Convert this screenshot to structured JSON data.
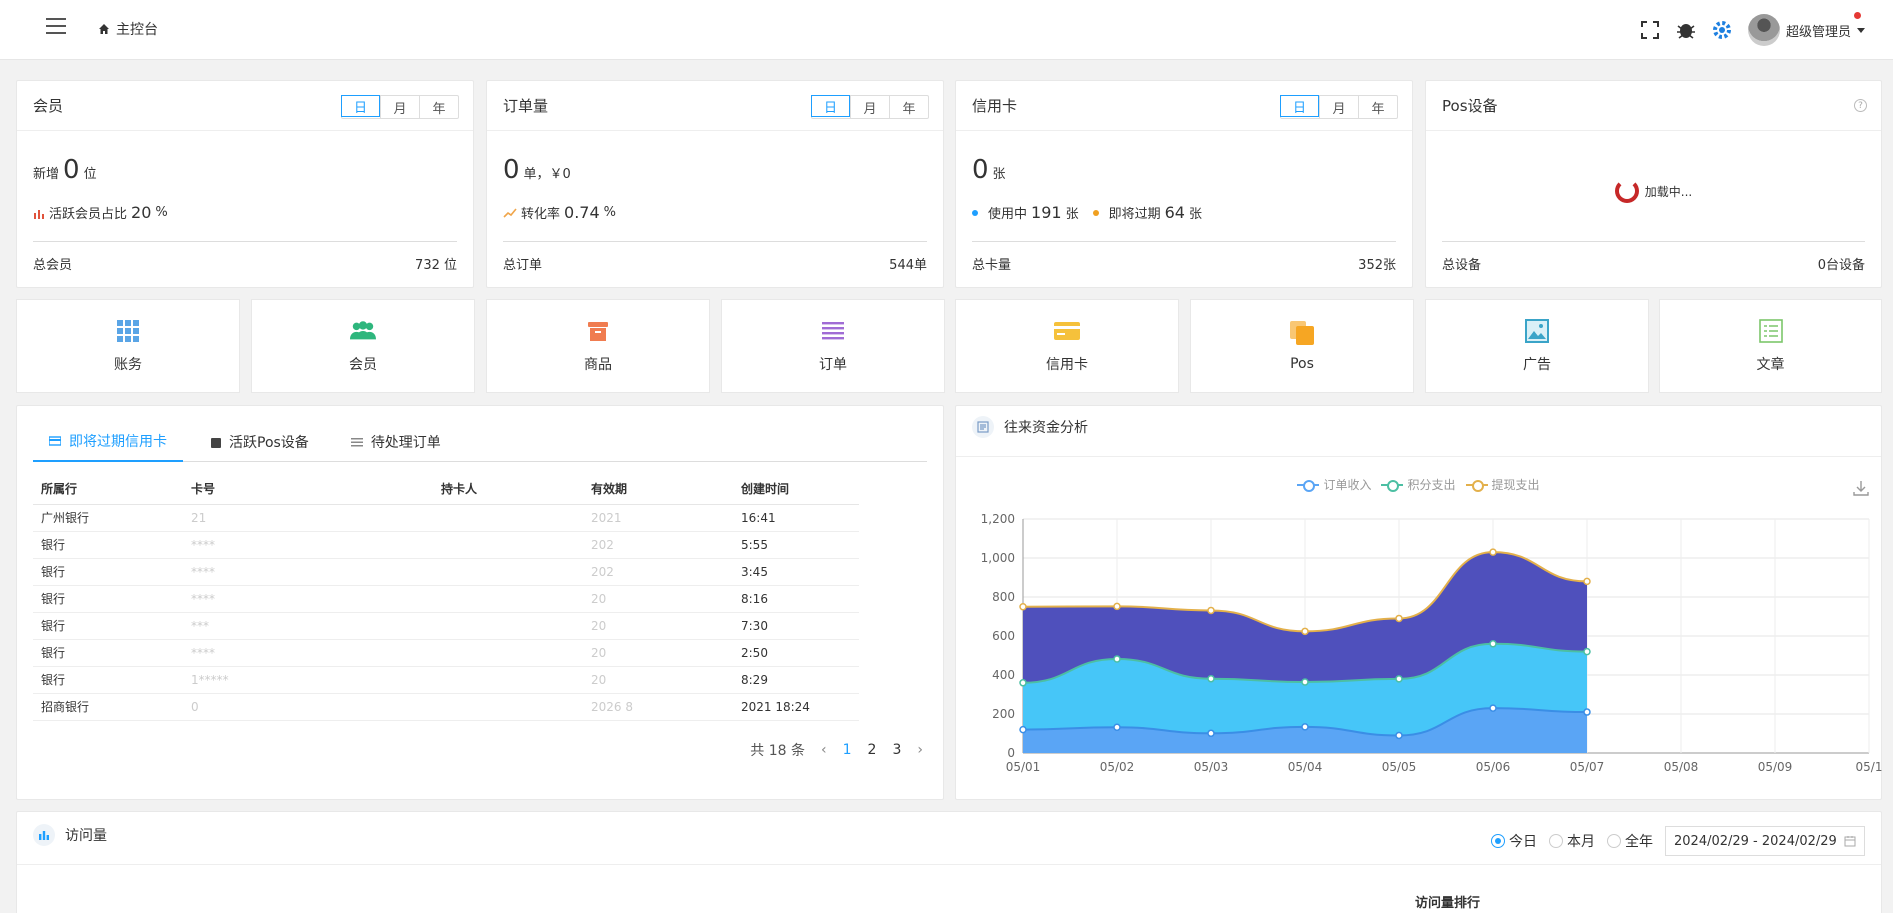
{
  "header": {
    "breadcrumb": "主控台",
    "user_name": "超级管理员",
    "icons": [
      "menu-icon",
      "home-icon",
      "fullscreen-icon",
      "bug-icon",
      "settings-icon"
    ]
  },
  "stats": [
    {
      "title": "会员",
      "tabs": [
        "日",
        "月",
        "年"
      ],
      "big": "0",
      "prefix": "新增",
      "unit": "位",
      "sub_label": "活跃会员占比",
      "sub_value": "20",
      "sub_unit": "%",
      "foot_label": "总会员",
      "foot_value": "732 位"
    },
    {
      "title": "订单量",
      "tabs": [
        "日",
        "月",
        "年"
      ],
      "big": "0",
      "unit": "单，￥0",
      "sub_label": "转化率",
      "sub_value": "0.74",
      "sub_unit": "%",
      "foot_label": "总订单",
      "foot_value": "544单"
    },
    {
      "title": "信用卡",
      "tabs": [
        "日",
        "月",
        "年"
      ],
      "big": "0",
      "unit": "张",
      "sub_a_label": "使用中",
      "sub_a_value": "191",
      "sub_a_unit": "张",
      "sub_b_label": "即将过期",
      "sub_b_value": "64",
      "sub_b_unit": "张",
      "foot_label": "总卡量",
      "foot_value": "352张"
    },
    {
      "title": "Pos设备",
      "loading_text": "加载中...",
      "foot_label": "总设备",
      "foot_value": "0台设备"
    }
  ],
  "quick_links": [
    {
      "label": "账务",
      "icon": "grid-icon",
      "color": "#5aa5e6"
    },
    {
      "label": "会员",
      "icon": "users-icon",
      "color": "#2eb67d"
    },
    {
      "label": "商品",
      "icon": "box-icon",
      "color": "#f07c50"
    },
    {
      "label": "订单",
      "icon": "list-icon",
      "color": "#a06cd5"
    },
    {
      "label": "信用卡",
      "icon": "card-icon",
      "color": "#f5c13b"
    },
    {
      "label": "Pos",
      "icon": "copy-icon",
      "color": "#f6a623"
    },
    {
      "label": "广告",
      "icon": "image-icon",
      "color": "#3aa4c8"
    },
    {
      "label": "文章",
      "icon": "doc-icon",
      "color": "#7cc66b"
    }
  ],
  "table_panel": {
    "tabs": [
      "即将过期信用卡",
      "活跃Pos设备",
      "待处理订单"
    ],
    "columns": [
      "所属行",
      "卡号",
      "持卡人",
      "有效期",
      "创建时间"
    ],
    "rows": [
      [
        "广州银行",
        "21",
        "",
        "2021",
        "16:41"
      ],
      [
        "银行",
        "****",
        "",
        "202",
        "5:55"
      ],
      [
        "银行",
        "****",
        "",
        "202",
        "3:45"
      ],
      [
        "银行",
        "****",
        "",
        "20",
        "8:16"
      ],
      [
        "银行",
        "***",
        "",
        "20",
        "7:30"
      ],
      [
        "银行",
        "****",
        "",
        "20",
        "2:50"
      ],
      [
        "银行",
        "1*****",
        "",
        "20",
        "8:29"
      ],
      [
        "招商银行",
        "0",
        "",
        "2026 8",
        "2021 18:24"
      ]
    ],
    "total_text": "共 18 条",
    "pages": [
      "1",
      "2",
      "3"
    ]
  },
  "chart_panel": {
    "title": "往来资金分析",
    "legend": [
      "订单收入",
      "积分支出",
      "提现支出"
    ]
  },
  "chart_data": {
    "type": "area",
    "x": [
      "05/01",
      "05/02",
      "05/03",
      "05/04",
      "05/05",
      "05/06",
      "05/07",
      "05/08",
      "05/09",
      "05/1"
    ],
    "ylim": [
      0,
      1200
    ],
    "yticks": [
      "0",
      "200",
      "400",
      "600",
      "800",
      "1,000",
      "1,200"
    ],
    "stacked": true,
    "series": [
      {
        "name": "订单收入",
        "values": [
          120,
          132,
          101,
          134,
          90,
          230,
          210
        ],
        "color": "#5aa5f5"
      },
      {
        "name": "积分支出",
        "values": [
          240,
          350,
          280,
          230,
          290,
          330,
          310
        ],
        "color": "#46c6f8"
      },
      {
        "name": "提现支出",
        "values": [
          390,
          270,
          350,
          260,
          310,
          470,
          360
        ],
        "color": "#4f50bc"
      }
    ],
    "grid": true
  },
  "visits": {
    "title": "访问量",
    "options": [
      "今日",
      "本月",
      "全年"
    ],
    "selected": "今日",
    "date_range": "2024/02/29 - 2024/02/29",
    "ranking_title": "访问量排行"
  }
}
